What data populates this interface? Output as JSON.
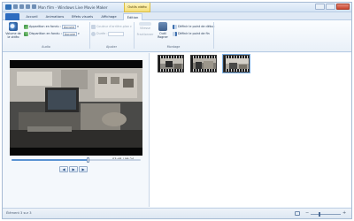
{
  "window": {
    "title": "Mon film - Windows Live Movie Maker",
    "context_tab": "Outils vidéo"
  },
  "tabs": {
    "file": "",
    "items": [
      {
        "label": "Accueil"
      },
      {
        "label": "Animations"
      },
      {
        "label": "Effets visuels"
      },
      {
        "label": "Affichage"
      },
      {
        "label": "Édition"
      }
    ],
    "active_index": 4
  },
  "ribbon": {
    "audio": {
      "volume_label": "Volume de la vidéo",
      "fade_in_label": "Apparition en fondu :",
      "fade_in_value": "Aucune",
      "fade_out_label": "Disparition en fondu :",
      "fade_out_value": "Aucune",
      "group_label": "Audio"
    },
    "adjust": {
      "bg_color_label": "Couleur d'arrière-plan",
      "duration_label": "Durée :",
      "group_label": "Ajuster"
    },
    "edit": {
      "split_label": "Fractionner",
      "trim_tool_label": "Outil Rogner",
      "start_point_label": "Définir le point de début",
      "end_point_label": "Définir le point de fin",
      "group_label": "Montage",
      "speed_label": "Vitesse"
    }
  },
  "preview": {
    "timecode": "03:48 / 06:24",
    "progress": 0.59,
    "controls": [
      {
        "name": "previous-frame-button",
        "glyph": "◀"
      },
      {
        "name": "play-button",
        "glyph": "▶"
      },
      {
        "name": "next-frame-button",
        "glyph": "▶"
      }
    ]
  },
  "storyboard": {
    "clips": [
      {
        "selected": false
      },
      {
        "selected": false
      },
      {
        "selected": true
      }
    ]
  },
  "status": {
    "text": "Élément 3 sur 3",
    "zoom": 0.3
  },
  "colors": {
    "accent": "#2d6cc0",
    "context_tab": "#f5df78",
    "selection": "#7fb2e6"
  }
}
